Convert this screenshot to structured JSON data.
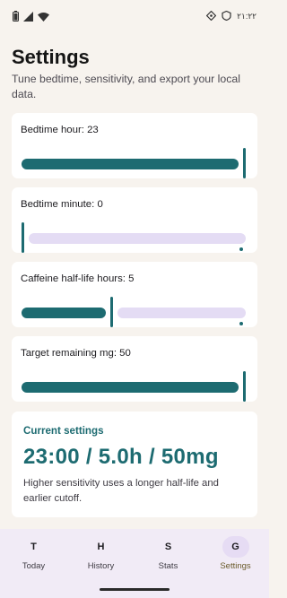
{
  "status_bar": {
    "time": "٢١:٢٢",
    "left_icons": [
      "battery-icon",
      "signal-icon",
      "wifi-icon"
    ],
    "right_icons": [
      "sync-icon",
      "data-saver-icon"
    ]
  },
  "header": {
    "title": "Settings",
    "subtitle": "Tune bedtime, sensitivity, and export your local data."
  },
  "sliders": [
    {
      "label": "Bedtime hour: 23",
      "value_fraction": 1.0
    },
    {
      "label": "Bedtime minute: 0",
      "value_fraction": 0.0
    },
    {
      "label": "Caffeine half-life hours: 5",
      "value_fraction": 0.4
    },
    {
      "label": "Target remaining mg: 50",
      "value_fraction": 1.0
    }
  ],
  "summary": {
    "heading": "Current settings",
    "value": "23:00 / 5.0h / 50mg",
    "note": "Higher sensitivity uses a longer half-life and earlier cutoff."
  },
  "nav": {
    "items": [
      {
        "icon": "T",
        "label": "Today"
      },
      {
        "icon": "H",
        "label": "History"
      },
      {
        "icon": "S",
        "label": "Stats"
      },
      {
        "icon": "G",
        "label": "Settings"
      }
    ],
    "active_index": 3
  },
  "colors": {
    "accent": "#1d6b71",
    "track_inactive": "#e4dcf4",
    "background": "#f7f3ee",
    "nav_background": "#f1ebf6"
  }
}
